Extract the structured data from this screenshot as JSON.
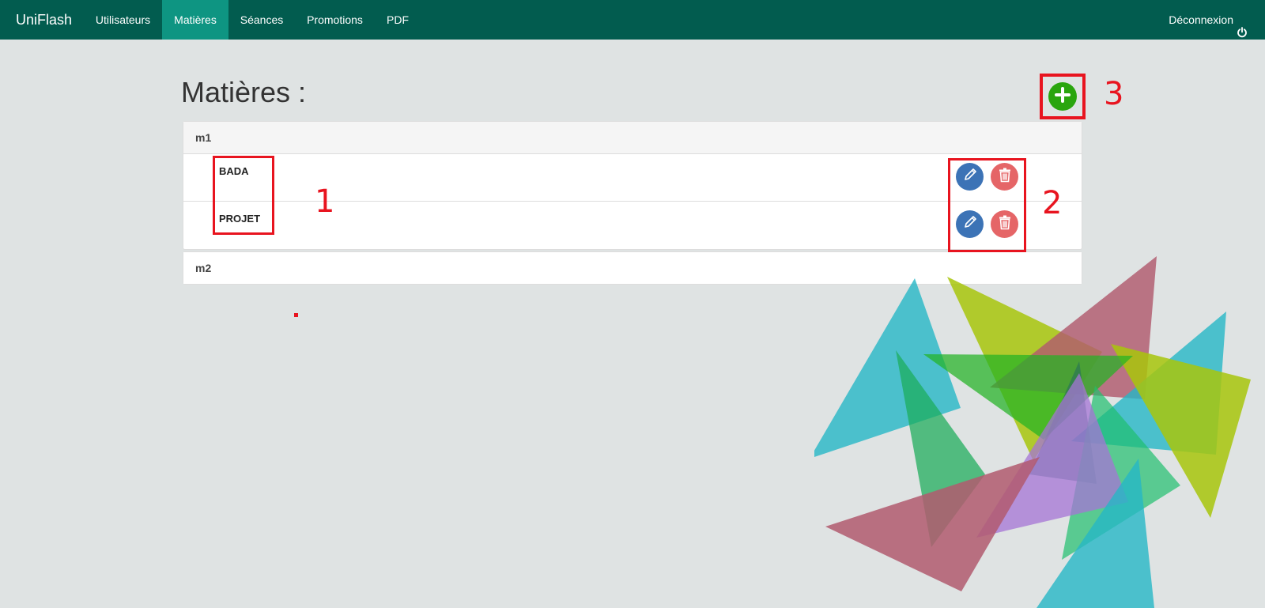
{
  "navbar": {
    "brand": "UniFlash",
    "items": [
      {
        "label": "Utilisateurs",
        "active": false
      },
      {
        "label": "Matières",
        "active": true
      },
      {
        "label": "Séances",
        "active": false
      },
      {
        "label": "Promotions",
        "active": false
      },
      {
        "label": "PDF",
        "active": false
      }
    ],
    "logout_label": "Déconnexion",
    "logout_icon": "power-icon"
  },
  "page": {
    "title": "Matières :",
    "add_icon": "plus-circle-icon"
  },
  "groups": [
    {
      "name": "m1",
      "expanded": true,
      "subjects": [
        {
          "label": "BADA",
          "edit_icon": "pencil-icon",
          "delete_icon": "trash-icon"
        },
        {
          "label": "PROJET",
          "edit_icon": "pencil-icon",
          "delete_icon": "trash-icon"
        }
      ]
    },
    {
      "name": "m2",
      "expanded": false,
      "subjects": []
    }
  ],
  "annotations": {
    "one": "1",
    "two": "2",
    "three": "3"
  },
  "colors": {
    "navbar": "#025c4f",
    "nav_active": "#0e9582",
    "background": "#dfe3e3",
    "add_button": "#2aa50e",
    "edit_button": "#3c73b6",
    "delete_button": "#e56567",
    "annotation_red": "#e8141f"
  }
}
